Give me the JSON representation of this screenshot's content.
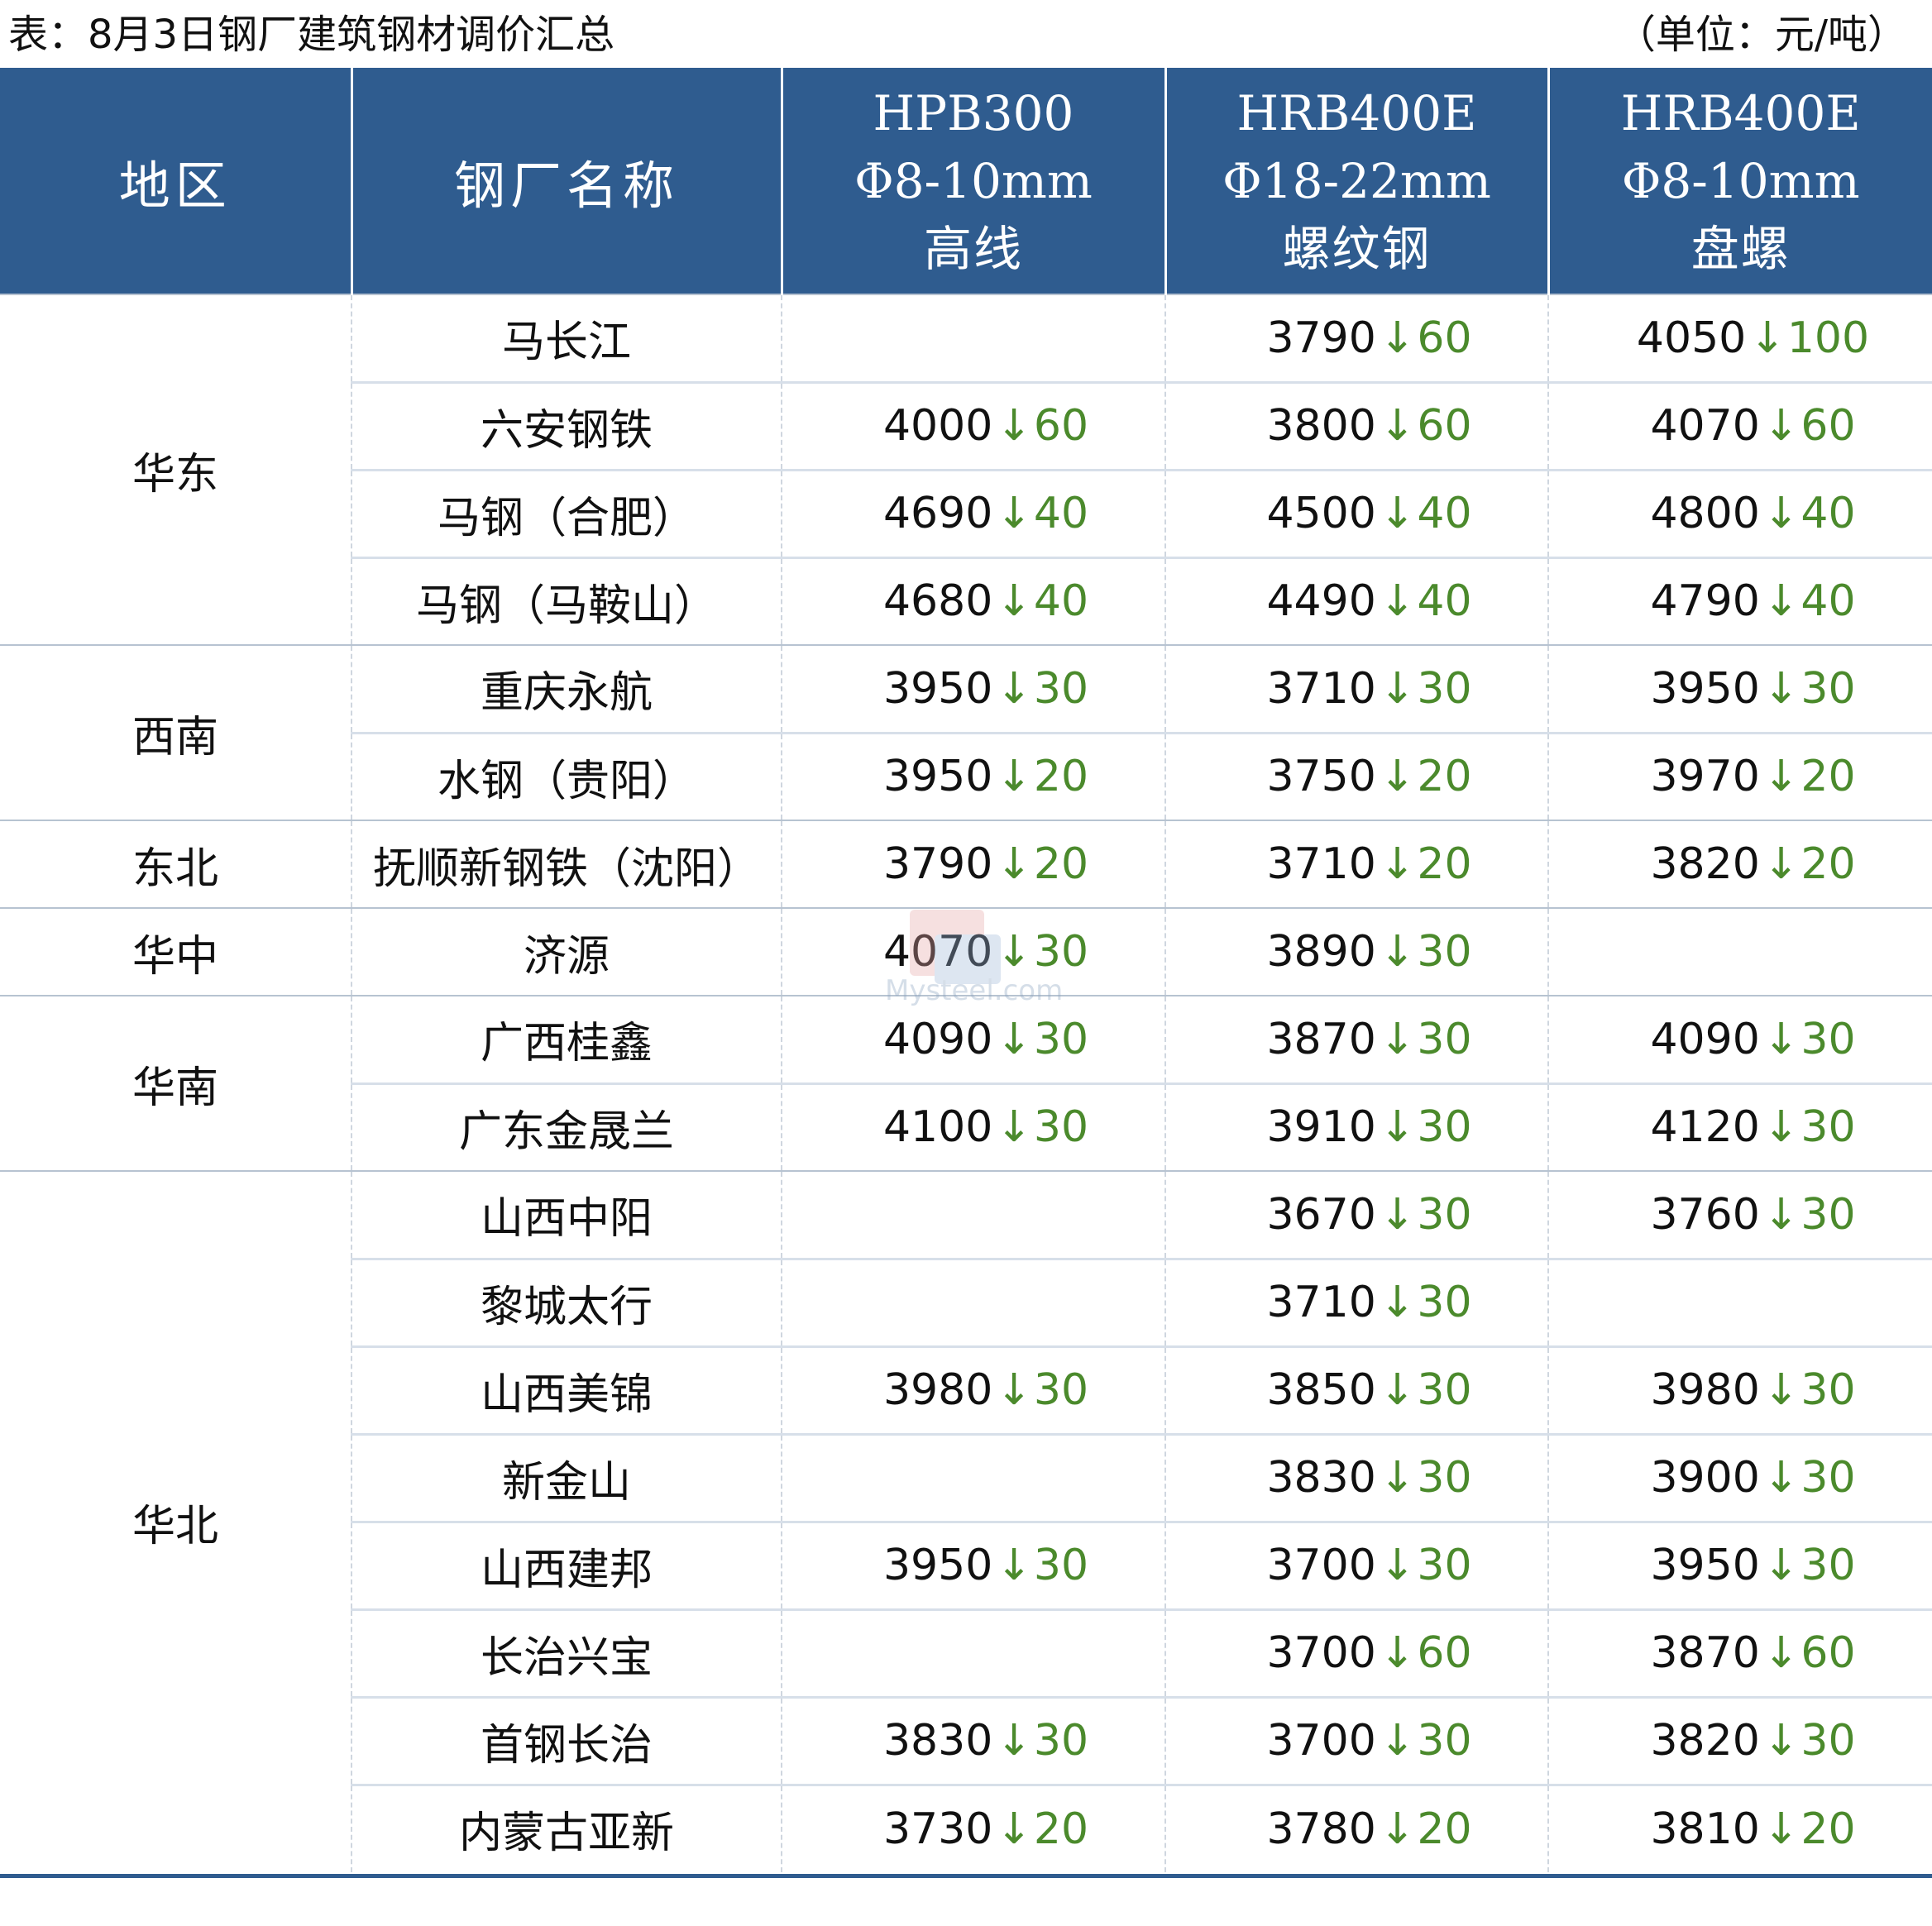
{
  "caption": {
    "title": "表：8月3日钢厂建筑钢材调价汇总",
    "unit": "（单位：元/吨）"
  },
  "headers": {
    "region": "地区",
    "mill": "钢厂名称",
    "col1": [
      "HPB300",
      "Φ8-10mm",
      "高线"
    ],
    "col2": [
      "HRB400E",
      "Φ18-22mm",
      "螺纹钢"
    ],
    "col3": [
      "HRB400E",
      "Φ8-10mm",
      "盘螺"
    ]
  },
  "arrow": "↓",
  "rows": [
    {
      "region": "华东",
      "span": 4,
      "mill": "马长江",
      "p1": "",
      "c1": "",
      "p2": "3790",
      "c2": "60",
      "p3": "4050",
      "c3": "100"
    },
    {
      "mill": "六安钢铁",
      "p1": "4000",
      "c1": "60",
      "p2": "3800",
      "c2": "60",
      "p3": "4070",
      "c3": "60"
    },
    {
      "mill": "马钢（合肥）",
      "p1": "4690",
      "c1": "40",
      "p2": "4500",
      "c2": "40",
      "p3": "4800",
      "c3": "40"
    },
    {
      "mill": "马钢（马鞍山）",
      "p1": "4680",
      "c1": "40",
      "p2": "4490",
      "c2": "40",
      "p3": "4790",
      "c3": "40"
    },
    {
      "region": "西南",
      "span": 2,
      "mill": "重庆永航",
      "p1": "3950",
      "c1": "30",
      "p2": "3710",
      "c2": "30",
      "p3": "3950",
      "c3": "30"
    },
    {
      "mill": "水钢（贵阳）",
      "p1": "3950",
      "c1": "20",
      "p2": "3750",
      "c2": "20",
      "p3": "3970",
      "c3": "20"
    },
    {
      "region": "东北",
      "span": 1,
      "mill": "抚顺新钢铁（沈阳）",
      "p1": "3790",
      "c1": "20",
      "p2": "3710",
      "c2": "20",
      "p3": "3820",
      "c3": "20"
    },
    {
      "region": "华中",
      "span": 1,
      "mill": "济源",
      "p1": "4070",
      "c1": "30",
      "p2": "3890",
      "c2": "30",
      "p3": "",
      "c3": ""
    },
    {
      "region": "华南",
      "span": 2,
      "mill": "广西桂鑫",
      "p1": "4090",
      "c1": "30",
      "p2": "3870",
      "c2": "30",
      "p3": "4090",
      "c3": "30"
    },
    {
      "mill": "广东金晟兰",
      "p1": "4100",
      "c1": "30",
      "p2": "3910",
      "c2": "30",
      "p3": "4120",
      "c3": "30"
    },
    {
      "region": "华北",
      "span": 8,
      "mill": "山西中阳",
      "p1": "",
      "c1": "",
      "p2": "3670",
      "c2": "30",
      "p3": "3760",
      "c3": "30"
    },
    {
      "mill": "黎城太行",
      "p1": "",
      "c1": "",
      "p2": "3710",
      "c2": "30",
      "p3": "",
      "c3": ""
    },
    {
      "mill": "山西美锦",
      "p1": "3980",
      "c1": "30",
      "p2": "3850",
      "c2": "30",
      "p3": "3980",
      "c3": "30"
    },
    {
      "mill": "新金山",
      "p1": "",
      "c1": "",
      "p2": "3830",
      "c2": "30",
      "p3": "3900",
      "c3": "30"
    },
    {
      "mill": "山西建邦",
      "p1": "3950",
      "c1": "30",
      "p2": "3700",
      "c2": "30",
      "p3": "3950",
      "c3": "30"
    },
    {
      "mill": "长治兴宝",
      "p1": "",
      "c1": "",
      "p2": "3700",
      "c2": "60",
      "p3": "3870",
      "c3": "60"
    },
    {
      "mill": "首钢长治",
      "p1": "3830",
      "c1": "30",
      "p2": "3700",
      "c2": "30",
      "p3": "3820",
      "c3": "30"
    },
    {
      "mill": "内蒙古亚新",
      "p1": "3730",
      "c1": "20",
      "p2": "3780",
      "c2": "20",
      "p3": "3810",
      "c3": "20"
    }
  ],
  "watermark": {
    "text": "Mysteel.com"
  },
  "colors": {
    "header_bg": "#2f5c8f",
    "change_green": "#4b8a2c"
  }
}
